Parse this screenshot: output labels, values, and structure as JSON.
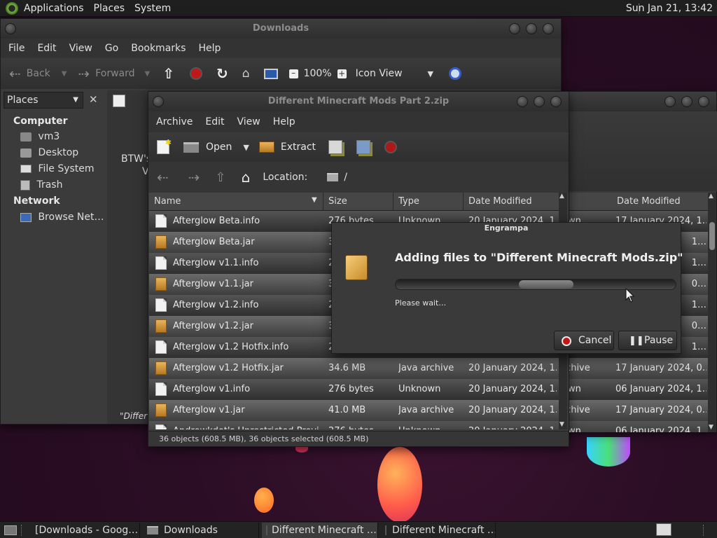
{
  "top_panel": {
    "menus": [
      "Applications",
      "Places",
      "System"
    ],
    "clock": "Sun Jan 21, 13:42"
  },
  "file_manager": {
    "title": "Downloads",
    "menus": [
      "File",
      "Edit",
      "View",
      "Go",
      "Bookmarks",
      "Help"
    ],
    "toolbar": {
      "back": "Back",
      "forward": "Forward",
      "zoom": "100%",
      "view_mode": "Icon View"
    },
    "sidebar": {
      "selector": "Places",
      "sections": [
        {
          "heading": "Computer",
          "items": [
            "vm3",
            "Desktop",
            "File System",
            "Trash"
          ]
        },
        {
          "heading": "Network",
          "items": [
            "Browse Net…"
          ]
        }
      ]
    },
    "content_fragments": [
      "BTW's",
      "V",
      "\"Differ"
    ]
  },
  "back_archive": {
    "header": "Date Modified",
    "rows": [
      [
        "own",
        "17 January 2024, 1…"
      ],
      [
        "",
        "1…"
      ],
      [
        "",
        "1…"
      ],
      [
        "",
        "0…"
      ],
      [
        "",
        "1…"
      ],
      [
        "",
        "0…"
      ],
      [
        "",
        "1…"
      ],
      [
        "rchive",
        "17 January 2024, 0…"
      ],
      [
        "own",
        "06 January 2024, 1…"
      ],
      [
        "rchive",
        "17 January 2024, 0…"
      ],
      [
        "own",
        "06 January 2024, 1…"
      ]
    ]
  },
  "archive": {
    "title": "Different Minecraft Mods Part 2.zip",
    "menus": [
      "Archive",
      "Edit",
      "View",
      "Help"
    ],
    "toolbar": {
      "open": "Open",
      "extract": "Extract"
    },
    "location_label": "Location:",
    "location_value": "/",
    "columns": [
      "Name",
      "Size",
      "Type",
      "Date Modified"
    ],
    "rows": [
      {
        "name": "Afterglow Beta.info",
        "size": "276 bytes",
        "type": "Unknown",
        "date": "20 January 2024, 1…",
        "kind": "doc"
      },
      {
        "name": "Afterglow Beta.jar",
        "size": "3",
        "type": "",
        "date": "",
        "kind": "jar"
      },
      {
        "name": "Afterglow v1.1.info",
        "size": "2",
        "type": "",
        "date": "",
        "kind": "doc"
      },
      {
        "name": "Afterglow v1.1.jar",
        "size": "3",
        "type": "",
        "date": "",
        "kind": "jar"
      },
      {
        "name": "Afterglow v1.2.info",
        "size": "2",
        "type": "",
        "date": "",
        "kind": "doc"
      },
      {
        "name": "Afterglow v1.2.jar",
        "size": "3",
        "type": "",
        "date": "",
        "kind": "jar"
      },
      {
        "name": "Afterglow v1.2 Hotfix.info",
        "size": "2",
        "type": "",
        "date": "",
        "kind": "doc"
      },
      {
        "name": "Afterglow v1.2 Hotfix.jar",
        "size": "34.6 MB",
        "type": "Java archive",
        "date": "20 January 2024, 1…",
        "kind": "jar"
      },
      {
        "name": "Afterglow v1.info",
        "size": "276 bytes",
        "type": "Unknown",
        "date": "20 January 2024, 1…",
        "kind": "doc"
      },
      {
        "name": "Afterglow v1.jar",
        "size": "41.0 MB",
        "type": "Java archive",
        "date": "20 January 2024, 1…",
        "kind": "jar"
      },
      {
        "name": "Andrewkdot's Unrestricted Provi…",
        "size": "276 bytes",
        "type": "Unknown",
        "date": "20 January 2024, 1…",
        "kind": "doc"
      }
    ],
    "status": "36 objects (608.5 MB), 36 objects selected (608.5 MB)"
  },
  "progress_dialog": {
    "title": "Engrampa",
    "heading": "Adding files to \"Different Minecraft Mods.zip\"",
    "status": "Please wait…",
    "cancel": "Cancel",
    "pause": "Pause"
  },
  "taskbar": {
    "items": [
      {
        "label": "[Downloads - Goog…",
        "active": false
      },
      {
        "label": "Downloads",
        "active": false
      },
      {
        "label": "Different Minecraft …",
        "active": true
      },
      {
        "label": "Different Minecraft …",
        "active": false
      }
    ]
  }
}
